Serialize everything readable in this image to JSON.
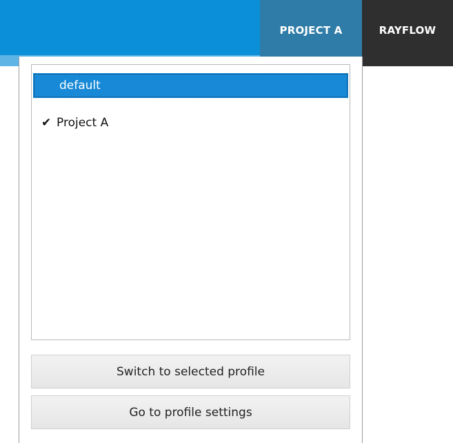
{
  "header": {
    "tabs": [
      {
        "label": "PROJECT A",
        "active": true
      },
      {
        "label": "RAYFLOW",
        "active": false
      }
    ]
  },
  "profile_menu": {
    "items": [
      {
        "label": "default",
        "selected": true,
        "checked": false
      },
      {
        "label": "Project A",
        "selected": false,
        "checked": true
      }
    ],
    "check_glyph": "✔",
    "switch_button": "Switch to selected profile",
    "settings_button": "Go to profile settings"
  },
  "colors": {
    "header_bg": "#0b8fd9",
    "active_tab_bg": "#2f7ca8",
    "rayflow_tab_bg": "#2f2f2f",
    "selection_bg": "#1789d6"
  }
}
